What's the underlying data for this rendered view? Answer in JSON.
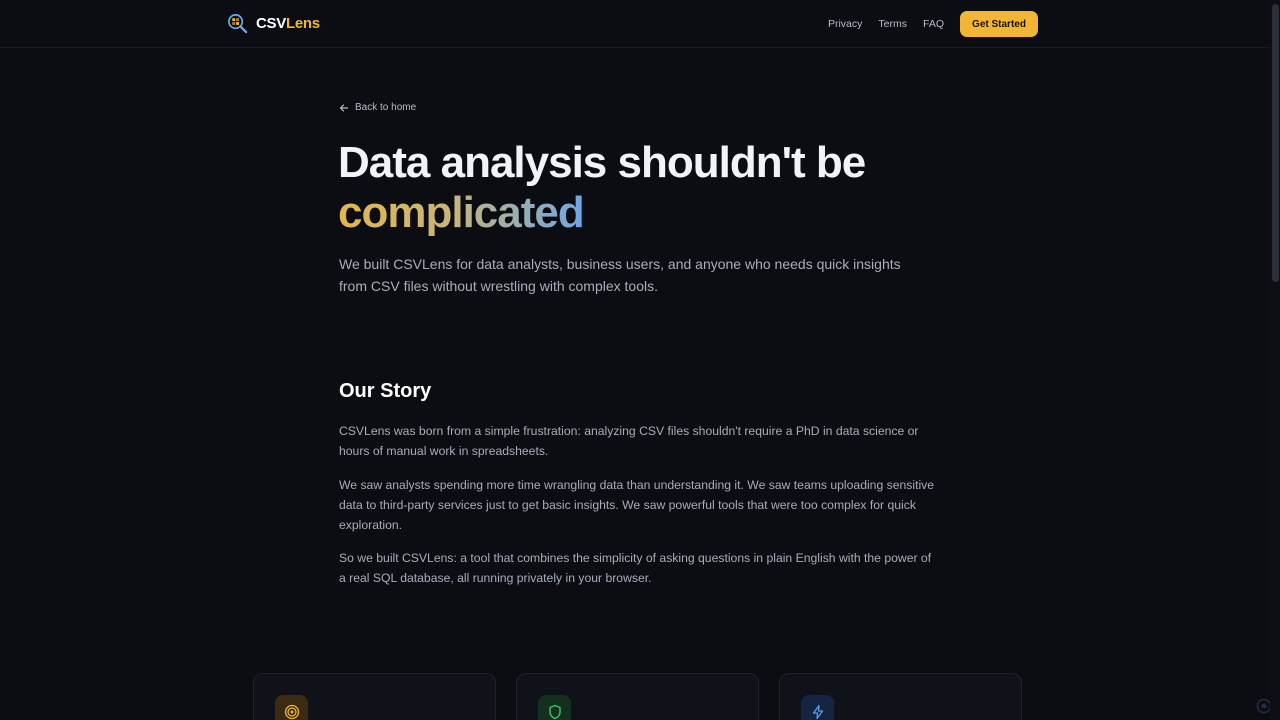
{
  "header": {
    "logo_main": "CSV",
    "logo_accent": "Lens",
    "nav": [
      {
        "label": "Privacy"
      },
      {
        "label": "Terms"
      },
      {
        "label": "FAQ"
      }
    ],
    "cta_label": "Get Started"
  },
  "hero": {
    "back_label": "Back to home",
    "title_line1": "Data analysis shouldn't be",
    "title_line2": "complicated",
    "subtitle": "We built CSVLens for data analysts, business users, and anyone who needs quick insights from CSV files without wrestling with complex tools."
  },
  "story": {
    "title": "Our Story",
    "paragraphs": [
      "CSVLens was born from a simple frustration: analyzing CSV files shouldn't require a PhD in data science or hours of manual work in spreadsheets.",
      "We saw analysts spending more time wrangling data than understanding it. We saw teams uploading sensitive data to third-party services just to get basic insights. We saw powerful tools that were too complex for quick exploration.",
      "So we built CSVLens: a tool that combines the simplicity of asking questions in plain English with the power of a real SQL database, all running privately in your browser."
    ]
  },
  "cards": [
    {
      "icon": "target-icon",
      "color": "#f0b63a"
    },
    {
      "icon": "shield-icon",
      "color": "#3ec46d"
    },
    {
      "icon": "lightning-icon",
      "color": "#5b9cf0"
    }
  ],
  "colors": {
    "background": "#0b0d12",
    "accent": "#f2b534",
    "text_muted": "#a7adba"
  }
}
